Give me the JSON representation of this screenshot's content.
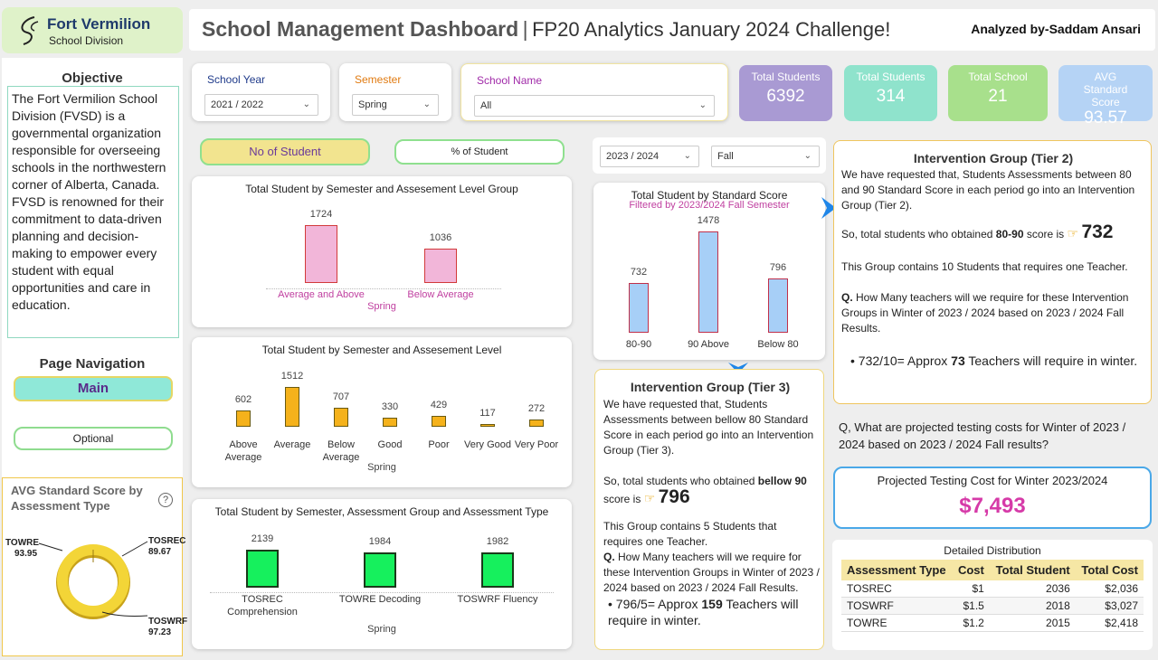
{
  "brand": {
    "name": "Fort Vermilion",
    "sub": "School Division"
  },
  "header": {
    "title_bold": "School Management Dashboard",
    "sep": "|",
    "title_rest": "FP20 Analytics January 2024 Challenge!",
    "author": "Analyzed by-Saddam Ansari"
  },
  "objective": {
    "title": "Objective",
    "text": "The Fort Vermilion School Division (FVSD) is a governmental organization responsible for overseeing schools in the northwestern corner of Alberta, Canada. FVSD is renowned for their commitment to data-driven planning and decision-making to empower every student with equal opportunities and care in education."
  },
  "nav": {
    "title": "Page Navigation",
    "main": "Main",
    "optional": "Optional"
  },
  "slicers": {
    "year_label": "School Year",
    "year_value": "2021 / 2022",
    "sem_label": "Semester",
    "sem_value": "Spring",
    "school_label": "School Name",
    "school_value": "All",
    "right_year": "2023 / 2024",
    "right_sem": "Fall"
  },
  "kpis": [
    {
      "title": "Total Students",
      "value": "6392",
      "color": "#a99ad3"
    },
    {
      "title": "Total Students",
      "value": "314",
      "color": "#8fe3cc"
    },
    {
      "title": "Total School",
      "value": "21",
      "color": "#a8e08c"
    },
    {
      "title": "AVG Standard Score",
      "value": "93.57",
      "color": "#b5d3f5"
    }
  ],
  "toggles": {
    "no": "No of Student",
    "pct": "% of Student"
  },
  "chart1": {
    "title": "Total Student by Semester and Assesement Level Group",
    "group": "Spring",
    "categories": [
      "Average and Above",
      "Below Average"
    ],
    "values": [
      1724,
      1036
    ],
    "labels": [
      "1724",
      "1036"
    ]
  },
  "chart2": {
    "title": "Total Student by Semester and Assesement Level",
    "group": "Spring",
    "categories": [
      "Above Average",
      "Average",
      "Below Average",
      "Good",
      "Poor",
      "Very Good",
      "Very Poor"
    ],
    "values": [
      602,
      1512,
      707,
      330,
      429,
      117,
      272
    ],
    "labels": [
      "602",
      "1512",
      "707",
      "330",
      "429",
      "117",
      "272"
    ]
  },
  "chart3": {
    "title": "Total Student by Semester, Assessment Group and Assessment Type",
    "group": "Spring",
    "categories": [
      "TOSREC Comprehension",
      "TOWRE Decoding",
      "TOSWRF Fluency"
    ],
    "values": [
      2139,
      1984,
      1982
    ],
    "labels": [
      "2139",
      "1984",
      "1982"
    ]
  },
  "chart4": {
    "title": "Total Student by Standard Score",
    "subtitle": "Filtered by 2023/2024 Fall Semester",
    "categories": [
      "80-90",
      "90 Above",
      "Below 80"
    ],
    "values": [
      732,
      1478,
      796
    ],
    "labels": [
      "732",
      "1478",
      "796"
    ]
  },
  "donut": {
    "title": "AVG Standard Score by Assessment Type",
    "help": "?",
    "items": [
      {
        "name": "TOWRE",
        "value": "93.95"
      },
      {
        "name": "TOSREC",
        "value": "89.67"
      },
      {
        "name": "TOSWRF",
        "value": "97.23"
      }
    ]
  },
  "tier3": {
    "title": "Intervention Group (Tier 3)",
    "p1": "We have requested that, Students Assessments between bellow 80 Standard Score in each period go into an Intervention Group (Tier 3).",
    "p2a": "So, total students who obtained ",
    "p2b": "bellow 90",
    "p2c": " score is",
    "p2v": "796",
    "p3": "This Group contains 5 Students that requires one Teacher.",
    "q": "Q.",
    "qt": " How Many teachers will we require for these Intervention Groups in Winter of 2023 / 2024 based on 2023 / 2024 Fall Results.",
    "ans_a": "796/5= Approx ",
    "ans_b": "159",
    "ans_c": " Teachers will require in winter."
  },
  "tier2": {
    "title": "Intervention Group (Tier 2)",
    "p1": "We have requested that, Students Assessments between 80 and 90 Standard Score in each period go into an Intervention Group (Tier 2).",
    "p2a": "So, total students who obtained ",
    "p2b": "80-90",
    "p2c": " score is",
    "p2v": "732",
    "p3": "This Group contains 10 Students that requires one Teacher.",
    "q": "Q.",
    "qt": " How Many teachers will we require for these Intervention Groups in Winter of 2023 / 2024 based on 2023 / 2024 Fall Results.",
    "ans_a": "732/10= Approx ",
    "ans_b": "73",
    "ans_c": " Teachers will require in winter."
  },
  "question2": "Q, What are projected testing costs for Winter of 2023 / 2024 based on 2023 / 2024 Fall results?",
  "cost": {
    "title": "Projected Testing Cost for Winter 2023/2024",
    "value": "$7,493"
  },
  "distribution": {
    "title": "Detailed Distribution",
    "headers": [
      "Assessment Type",
      "Cost",
      "Total Student",
      "Total Cost"
    ],
    "rows": [
      [
        "TOSREC",
        "$1",
        "2036",
        "$2,036"
      ],
      [
        "TOSWRF",
        "$1.5",
        "2018",
        "$3,027"
      ],
      [
        "TOWRE",
        "$1.2",
        "2015",
        "$2,418"
      ]
    ]
  },
  "colors": {
    "pink": "#f2b6d9",
    "orange": "#f5b21b",
    "green": "#16f05d",
    "blue": "#a7cff7",
    "magenta": "#d63aa8"
  }
}
